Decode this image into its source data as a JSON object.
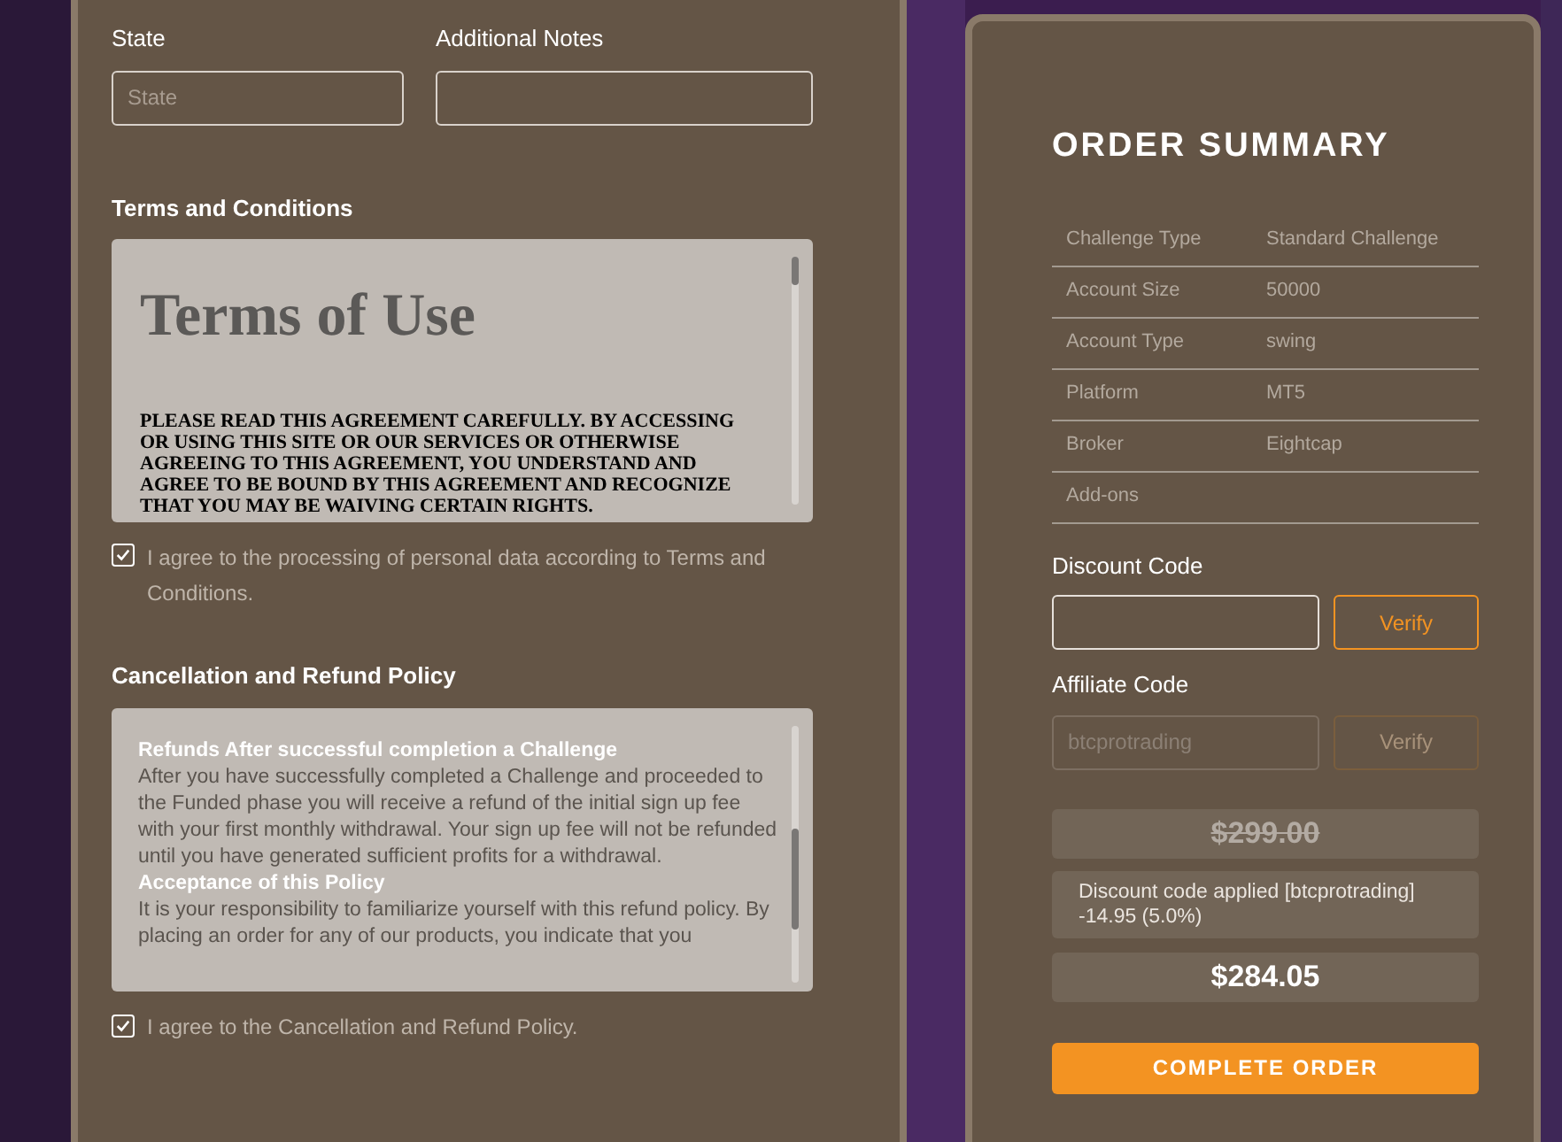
{
  "form": {
    "fields": [
      {
        "label": "State",
        "placeholder": "State"
      },
      {
        "label": "Additional Notes"
      }
    ]
  },
  "terms": {
    "heading": "Terms and Conditions",
    "doc_title": "Terms of Use",
    "doc_text": "PLEASE READ THIS AGREEMENT CAREFULLY. BY ACCESSING OR USING THIS SITE OR OUR SERVICES OR OTHERWISE AGREEING TO THIS AGREEMENT, YOU UNDERSTAND AND AGREE TO BE BOUND BY THIS AGREEMENT AND RECOGNIZE THAT YOU MAY BE WAIVING CERTAIN RIGHTS.",
    "agree": {
      "label": "I agree to the processing of personal data according to Terms and Conditions.",
      "checked": true
    }
  },
  "refund": {
    "heading": "Cancellation and Refund Policy",
    "blocks": [
      {
        "kind": "heading",
        "text": "Refunds After successful completion a Challenge"
      },
      {
        "kind": "paragraph",
        "text": "After you have successfully completed a Challenge and proceeded to the Funded phase you will receive a refund of the initial sign up fee with your first monthly withdrawal. Your sign up fee will not be refunded until you have generated sufficient profits for a withdrawal."
      },
      {
        "kind": "heading",
        "text": "Acceptance of this Policy"
      },
      {
        "kind": "paragraph",
        "text": "It is your responsibility to familiarize yourself with this refund policy. By placing an order for any of our products, you indicate that you"
      }
    ],
    "agree": {
      "label": "I agree to the Cancellation and Refund Policy.",
      "checked": true
    }
  },
  "summary": {
    "title": "ORDER SUMMARY",
    "rows": [
      {
        "label": "Challenge Type",
        "value": "Standard Challenge"
      },
      {
        "label": "Account Size",
        "value": "50000"
      },
      {
        "label": "Account Type",
        "value": "swing"
      },
      {
        "label": "Platform",
        "value": "MT5"
      },
      {
        "label": "Broker",
        "value": "Eightcap"
      },
      {
        "label": "Add-ons"
      }
    ],
    "codes": [
      {
        "label": "Discount Code",
        "button": "Verify",
        "disabled": false
      },
      {
        "label": "Affiliate Code",
        "value": "btcprotrading",
        "button": "Verify",
        "disabled": true
      }
    ],
    "original_price": "$299.00",
    "discount_note": "Discount code applied [btcprotrading] -14.95 (5.0%)",
    "total": "$284.05",
    "submit": "COMPLETE ORDER"
  }
}
